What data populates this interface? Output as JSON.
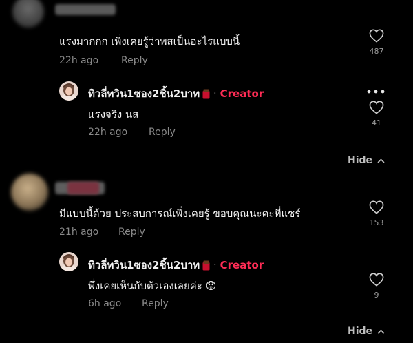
{
  "comments": [
    {
      "text": "แรงมากกก เพิ่งเคยรู้ว่าพสเป็นอะไรแบบนี้",
      "time": "22h ago",
      "reply_label": "Reply",
      "likes": "487",
      "reply": {
        "name": "ทิวลี่ทวิน1ซอง2ชิ้น2บาท",
        "badge": "Creator",
        "separator": "·",
        "text": "แรงจริง นส",
        "time": "22h ago",
        "reply_label": "Reply",
        "likes": "41",
        "more": "•••"
      },
      "hide_label": "Hide"
    },
    {
      "text": "มีแบบนี้ด้วย ประสบการณ์เพิ่งเคยรู้ ขอบคุณนะคะที่แชร์",
      "time": "21h ago",
      "reply_label": "Reply",
      "likes": "153",
      "reply": {
        "name": "ทิวลี่ทวิน1ซอง2ชิ้น2บาท",
        "badge": "Creator",
        "separator": "·",
        "text": "พึ่งเคยเห็นกับตัวเองเลยค่ะ 😟",
        "time": "6h ago",
        "reply_label": "Reply",
        "likes": "9"
      },
      "hide_label": "Hide"
    }
  ],
  "colors": {
    "background": "#000000",
    "creator": "#fe2c55",
    "meta": "#8a8a8a"
  }
}
